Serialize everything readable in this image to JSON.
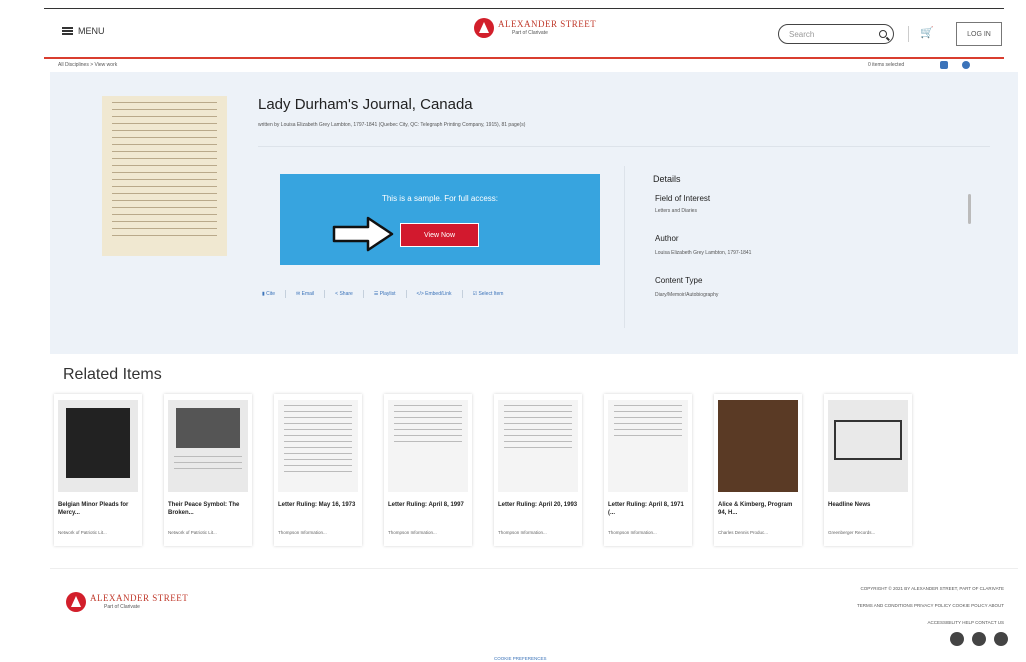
{
  "header": {
    "menu_label": "MENU",
    "logo_name": "ALEXANDER STREET",
    "logo_sub": "Part of Clarivate",
    "search_placeholder": "Search",
    "login_label": "LOG IN"
  },
  "breadcrumb": "All Disciplines > View work",
  "items_selected": "0 items selected",
  "work": {
    "title": "Lady Durham's Journal, Canada",
    "byline": "written by Louisa Elizabeth Grey Lambton, 1797-1841 (Quebec City, QC: Telegraph Printing Company, 1915), 81 page(s)"
  },
  "sample": {
    "text": "This is a sample. For full access:",
    "button": "View Now"
  },
  "actions": [
    "Cite",
    "Email",
    "Share",
    "Playlist",
    "Embed/Link",
    "Select Item"
  ],
  "details": {
    "title": "Details",
    "fields": [
      {
        "label": "Field of Interest",
        "value": "Letters and Diaries"
      },
      {
        "label": "Author",
        "value": "Louisa Elizabeth Grey Lambton, 1797-1841"
      },
      {
        "label": "Content Type",
        "value": "Diary/Memoir/Autobiography"
      }
    ]
  },
  "related": {
    "heading": "Related Items",
    "items": [
      {
        "title": "Belgian Minor Pleads for Mercy...",
        "publisher": "Network of Patriotic Lit..."
      },
      {
        "title": "Their Peace Symbol: The Broken...",
        "publisher": "Network of Patriotic Lit..."
      },
      {
        "title": "Letter Ruling: May 16, 1973",
        "publisher": "Thompson Information..."
      },
      {
        "title": "Letter Ruling: April 8, 1997",
        "publisher": "Thompson Information..."
      },
      {
        "title": "Letter Ruling: April 20, 1993",
        "publisher": "Thompson Information..."
      },
      {
        "title": "Letter Ruling: April 8, 1971 (...",
        "publisher": "Thompson Information..."
      },
      {
        "title": "Alice & Kimberg, Program 94, H...",
        "publisher": "Charles Dennis Produc..."
      },
      {
        "title": "Headline News",
        "publisher": "Greenberger Records..."
      }
    ]
  },
  "footer": {
    "copyright": "COPYRIGHT © 2021 BY ALEXANDER STREET, PART OF CLARIVATE",
    "links_row1": "TERMS AND CONDITIONS    PRIVACY POLICY    COOKIE POLICY    ABOUT",
    "links_row2": "ACCESSIBILITY    HELP    CONTACT US",
    "cookie_prefs": "COOKIE PREFERENCES",
    "social": [
      "facebook-icon",
      "instagram-icon",
      "twitter-icon"
    ]
  },
  "colors": {
    "brand_red": "#d2192e",
    "sample_blue": "#37a4df",
    "hero_bg": "#edf2f8",
    "link_blue": "#3b73b9"
  }
}
